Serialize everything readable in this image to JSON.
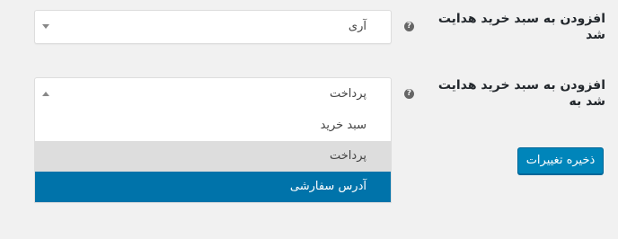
{
  "settings": [
    {
      "label": "افزودن به سبد خرید هدایت شد",
      "help": "?",
      "select": {
        "value": "آری",
        "expanded": false
      }
    },
    {
      "label": "افزودن به سبد خرید هدایت شد به",
      "help": "?",
      "select": {
        "value": "پرداخت",
        "expanded": true,
        "options": [
          "سبد خرید",
          "پرداخت",
          "آدرس سفارشی"
        ],
        "hovered_index": 1,
        "selected_index": 2
      }
    }
  ],
  "save_button": {
    "label": "ذخیره تغییرات"
  },
  "colors": {
    "background": "#f1f1f1",
    "primary": "#0085ba",
    "selected_option": "#0073aa",
    "hover_option": "#dddddd"
  }
}
